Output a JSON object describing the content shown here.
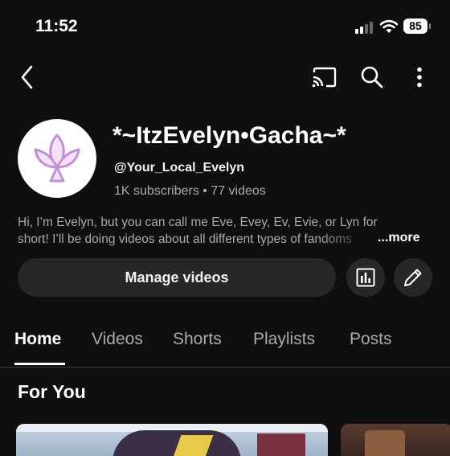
{
  "status_bar": {
    "time": "11:52",
    "battery": "85"
  },
  "channel": {
    "title": "*~ItzEvelyn•Gacha~*",
    "handle": "@Your_Local_Evelyn",
    "stats": "1K subscribers • 77 videos",
    "description_line1": "Hi, I’m Evelyn, but you can call me Eve, Evey, Ev, Evie, or Lyn for",
    "description_line2": "short! I’ll be doing videos about all different types of fandoms",
    "more_label": "...more"
  },
  "actions": {
    "manage_label": "Manage videos"
  },
  "tabs": [
    {
      "label": "Home"
    },
    {
      "label": "Videos"
    },
    {
      "label": "Shorts"
    },
    {
      "label": "Playlists"
    },
    {
      "label": "Posts"
    }
  ],
  "section_title": "For You",
  "icons": {
    "back": "back-arrow-icon",
    "cast": "cast-icon",
    "search": "search-icon",
    "more": "more-vert-icon",
    "analytics": "analytics-icon",
    "edit": "pencil-icon",
    "avatar": "lotus-logo"
  },
  "colors": {
    "background": "#0f0f0f",
    "button": "#272727",
    "secondary_text": "#aaaaaa",
    "avatar_logo": "#c48fd6"
  }
}
